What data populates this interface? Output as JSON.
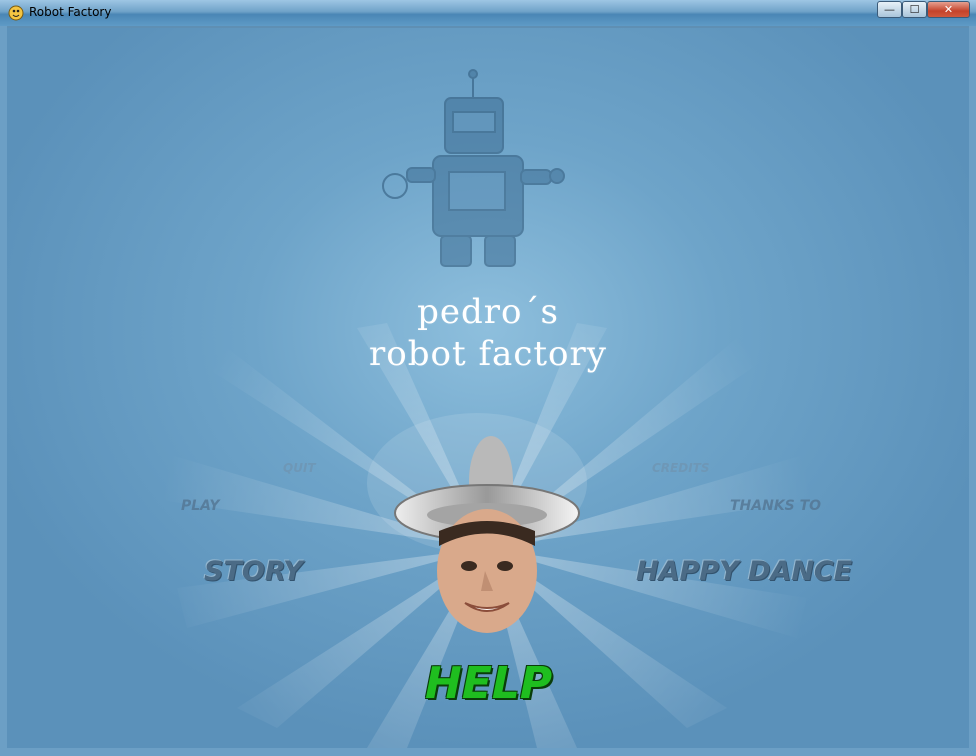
{
  "window": {
    "title": "Robot Factory",
    "buttons": {
      "minimize": "—",
      "maximize": "☐",
      "close": "✕"
    }
  },
  "game": {
    "title_line1": "pedro´s",
    "title_line2": "robot factory",
    "menu": {
      "quit": "QUIT",
      "play": "PLAY",
      "story": "STORY",
      "credits": "CREDITS",
      "thanks_to": "THANKS TO",
      "happy_dance": "HAPPY DANCE",
      "help": "HELP"
    },
    "selected_item": "help",
    "colors": {
      "selected": "#1fbe1f",
      "normal": "#4b6b86",
      "background": "#6ea4c9"
    }
  }
}
